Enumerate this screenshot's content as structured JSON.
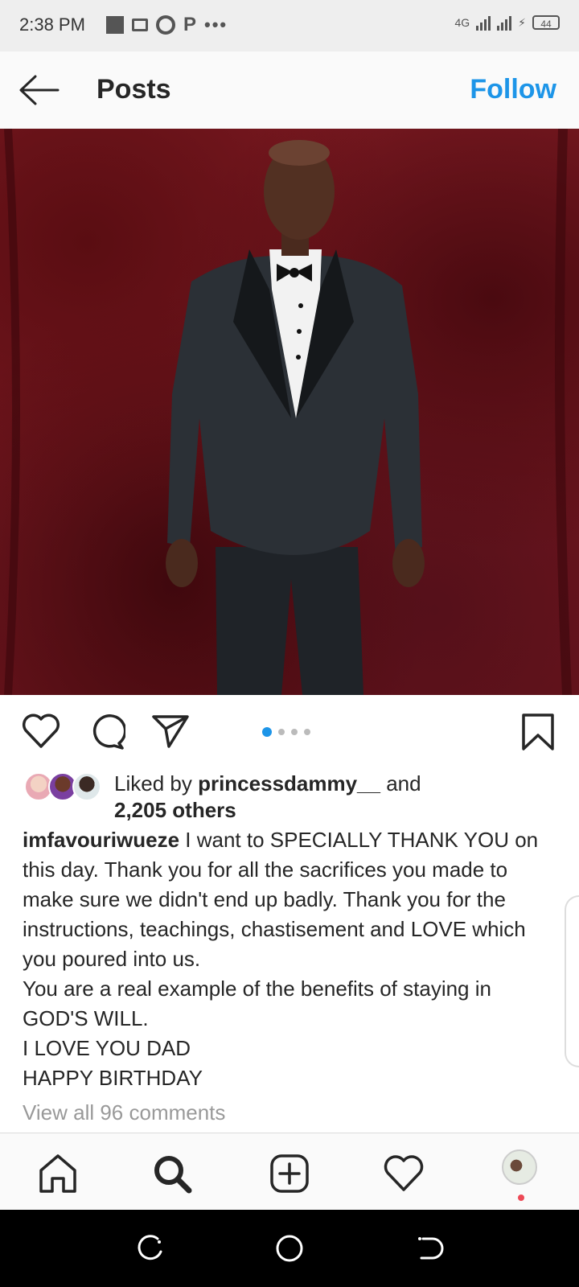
{
  "status_bar": {
    "time": "2:38 PM",
    "network": "4G",
    "battery": "44"
  },
  "header": {
    "back_icon": "arrow-left-icon",
    "title": "Posts",
    "follow_label": "Follow"
  },
  "post": {
    "photo_alt": "man in black tuxedo",
    "carousel": {
      "total": 4,
      "active": 1
    },
    "likes": {
      "prefix": "Liked by ",
      "user": "princessdammy__",
      "middle": " and",
      "others": "2,205 others"
    },
    "caption": {
      "username": "imfavouriwueze",
      "first_line": " I want to SPECIALLY THANK YOU on this day. Thank you for all the sacrifices you made to make sure we didn't end up badly. Thank you for the instructions, teachings, chastisement and LOVE which you poured into us.",
      "line2": "You are a real example of the benefits of staying in GOD'S WILL.",
      "line3": "I LOVE YOU DAD",
      "line4": "HAPPY BIRTHDAY"
    },
    "view_comments": "View all 96 comments"
  },
  "colors": {
    "accent": "#1d95e8",
    "notification": "#ed4956"
  },
  "icons": {
    "like": "heart-icon",
    "comment": "comment-icon",
    "share": "send-icon",
    "save": "bookmark-icon",
    "nav": [
      "home-icon",
      "search-icon",
      "add-post-icon",
      "activity-heart-icon",
      "profile-avatar"
    ]
  }
}
